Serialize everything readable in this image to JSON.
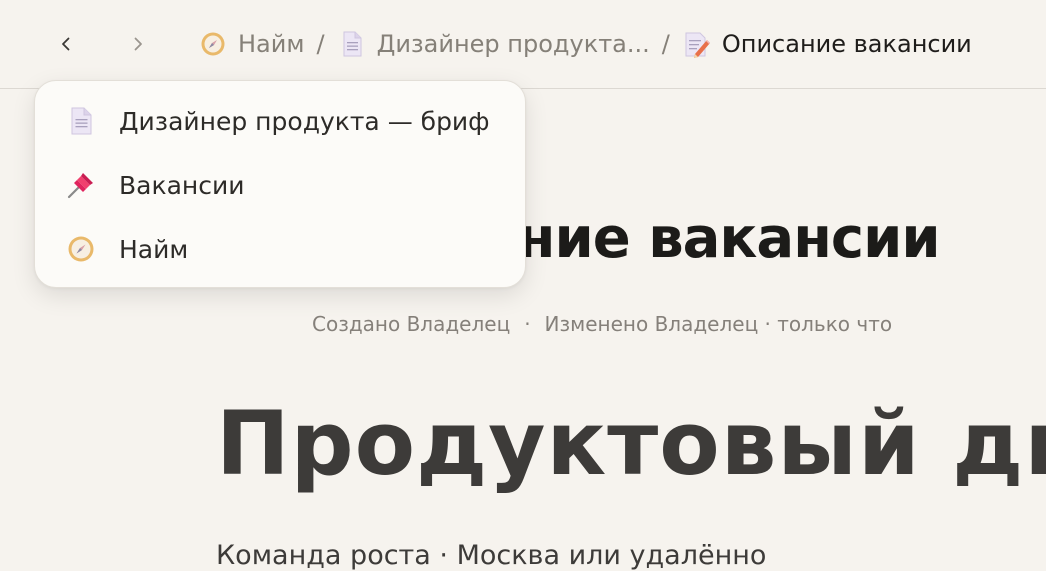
{
  "nav": {
    "back_icon": "chevron-left-icon",
    "forward_icon": "chevron-right-icon"
  },
  "breadcrumb": {
    "items": [
      {
        "label": "Найм",
        "icon": "compass-icon"
      },
      {
        "label": "Дизайнер продукта...",
        "icon": "document-icon"
      },
      {
        "label": "Описание вакансии",
        "icon": "memo-icon"
      }
    ],
    "separator": "/"
  },
  "dropdown": {
    "items": [
      {
        "label": "Дизайнер продукта — бриф",
        "icon": "document-icon"
      },
      {
        "label": "Вакансии",
        "icon": "pushpin-icon"
      },
      {
        "label": "Найм",
        "icon": "compass-icon"
      }
    ]
  },
  "page": {
    "title_visible": "ание вакансии",
    "meta_created": "Создано Владелец",
    "meta_dot": "·",
    "meta_modified": "Изменено Владелец · только что",
    "hero": "Продуктовый ди",
    "subline": "Команда роста · Москва или удалённо"
  },
  "colors": {
    "background": "#f6f3ee",
    "dropdown_bg": "#fcfbf8",
    "muted_text": "#858078",
    "pushpin": "#e0245e"
  }
}
